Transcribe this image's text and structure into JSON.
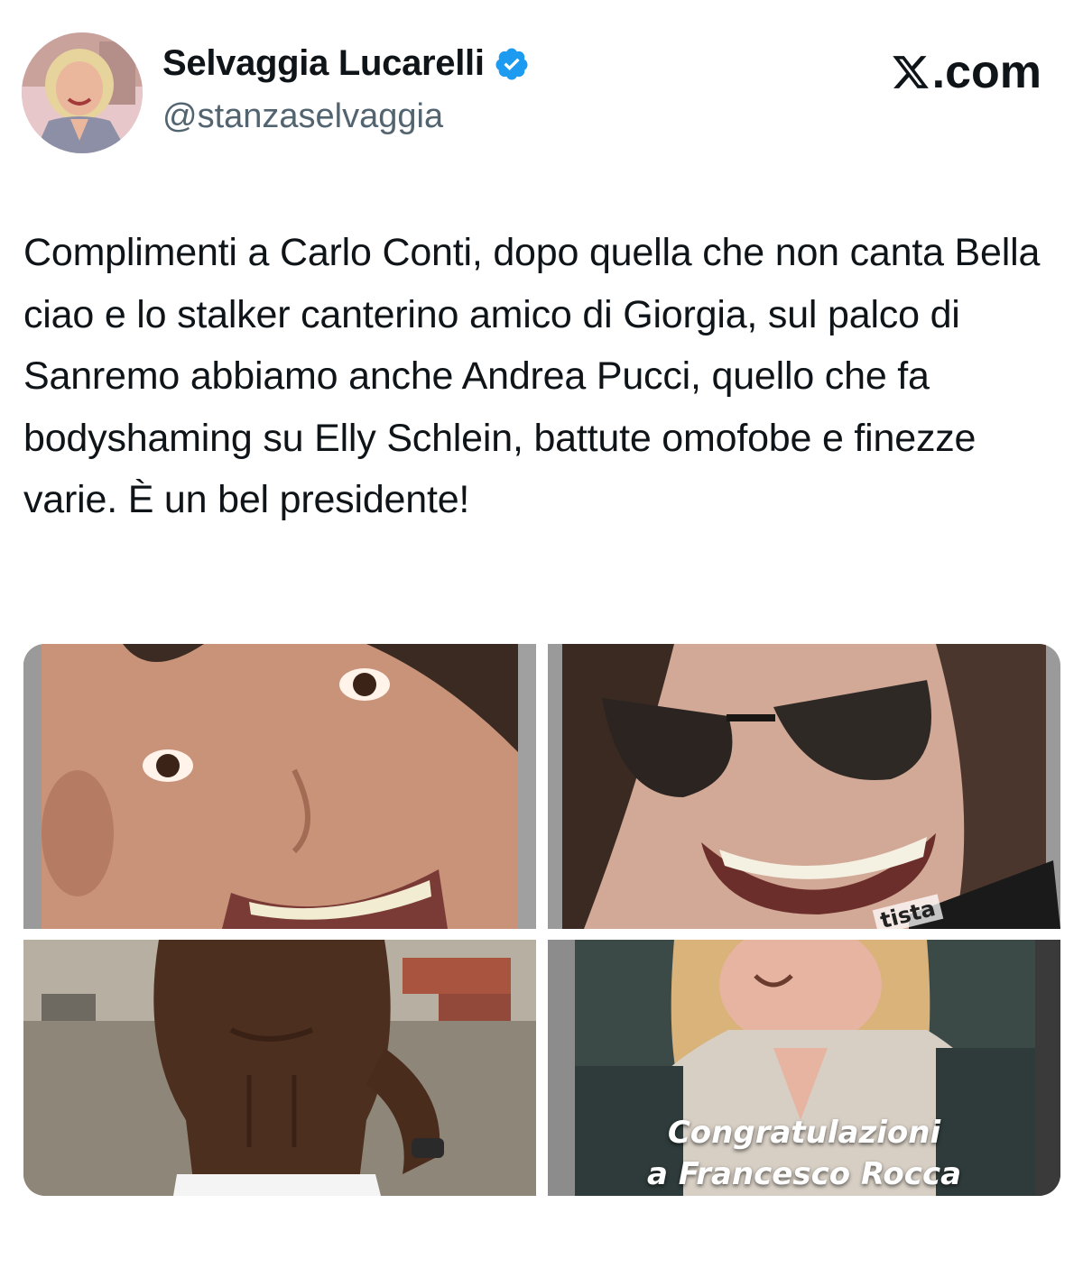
{
  "author": {
    "display_name": "Selvaggia Lucarelli",
    "handle": "@stanzaselvaggia",
    "verified_icon": "verified-badge-icon",
    "avatar_icon": "avatar-photo"
  },
  "brand": {
    "logo_icon": "x-logo-icon",
    "suffix": ".com"
  },
  "tweet": {
    "text": "Complimenti a Carlo Conti, dopo quella che non canta Bella ciao e lo stalker canterino amico di Giorgia, sul palco di Sanremo abbiamo anche Andrea Pucci, quello che fa bodyshaming su Elly Schlein, battute omofobe e finezze varie. È un bel presidente!"
  },
  "media": {
    "items": [
      {
        "description_icon": "photo-smiling-face-closeup"
      },
      {
        "description_icon": "photo-face-sunglasses",
        "overlay_text": "tista"
      },
      {
        "description_icon": "photo-shirtless-man-beach"
      },
      {
        "description_icon": "photo-woman-smiling",
        "caption_line1": "Congratulazioni",
        "caption_line2": "a Francesco Rocca"
      }
    ]
  },
  "colors": {
    "verified_blue": "#1d9bf0",
    "text_primary": "#0f1419",
    "text_secondary": "#536471"
  }
}
